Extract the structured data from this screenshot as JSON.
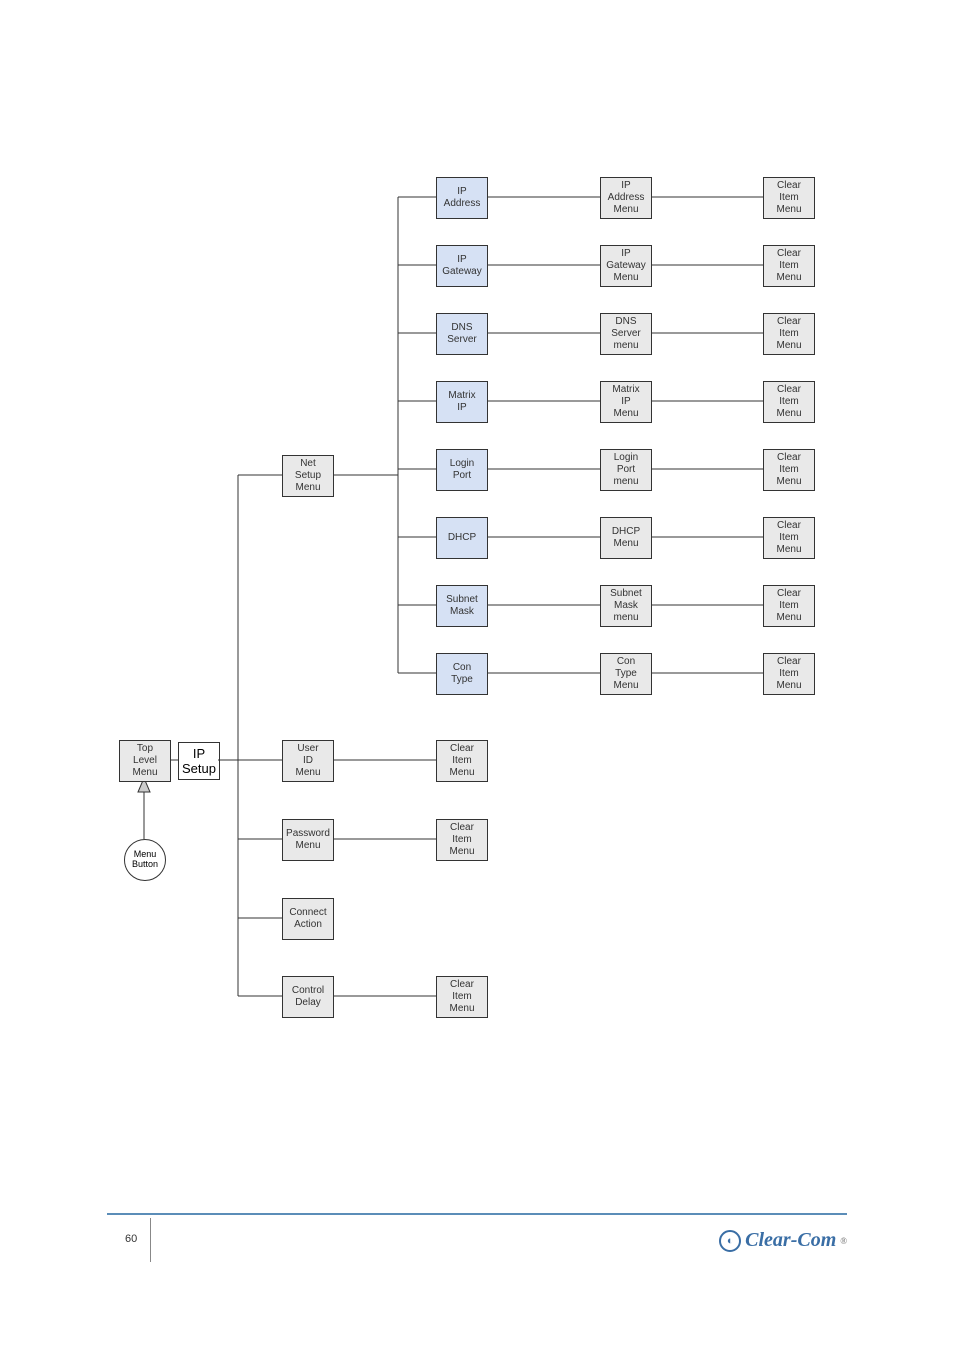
{
  "page_number": "60",
  "brand": "Clear-Com",
  "start": {
    "menu_button": "Menu\nButton",
    "top_level_menu": "Top\nLevel\nMenu",
    "ip_setup": "IP\nSetup"
  },
  "col2": {
    "net_setup": "Net\nSetup\nMenu",
    "user_id": "User\nID\nMenu",
    "password": "Password\nMenu",
    "connect": "Connect\nAction",
    "control_delay": "Control\nDelay"
  },
  "net_items": [
    {
      "label": "IP\nAddress",
      "menu": "IP\nAddress\nMenu",
      "clear": "Clear\nItem\nMenu"
    },
    {
      "label": "IP\nGateway",
      "menu": "IP\nGateway\nMenu",
      "clear": "Clear\nItem\nMenu"
    },
    {
      "label": "DNS\nServer",
      "menu": "DNS\nServer\nmenu",
      "clear": "Clear\nItem\nMenu"
    },
    {
      "label": "Matrix\nIP",
      "menu": "Matrix\nIP\nMenu",
      "clear": "Clear\nItem\nMenu"
    },
    {
      "label": "Login\nPort",
      "menu": "Login\nPort\nmenu",
      "clear": "Clear\nItem\nMenu"
    },
    {
      "label": "DHCP",
      "menu": "DHCP\nMenu",
      "clear": "Clear\nItem\nMenu"
    },
    {
      "label": "Subnet\nMask",
      "menu": "Subnet\nMask\nmenu",
      "clear": "Clear\nItem\nMenu"
    },
    {
      "label": "Con\nType",
      "menu": "Con\nType\nMenu",
      "clear": "Clear\nItem\nMenu"
    }
  ],
  "clear_item": "Clear\nItem\nMenu"
}
